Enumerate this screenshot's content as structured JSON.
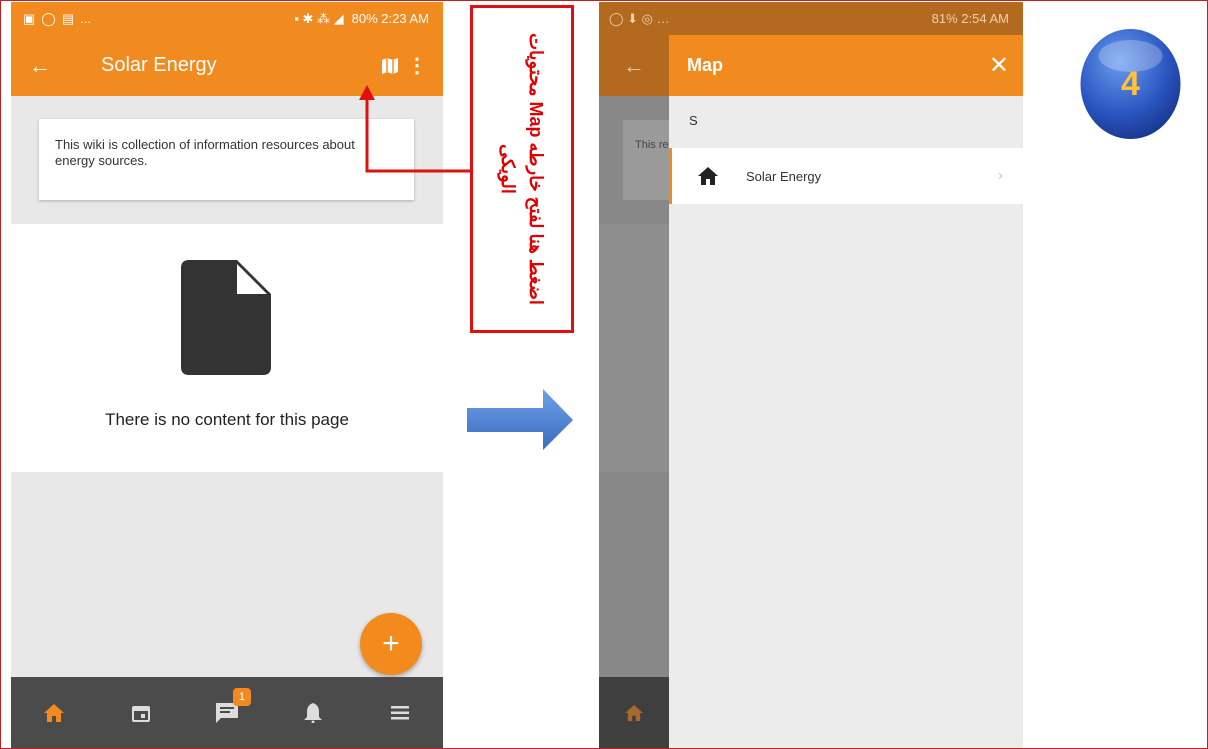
{
  "phone1": {
    "status_left_icons": [
      "image-icon",
      "whatsapp-icon",
      "gallery-icon",
      "..."
    ],
    "status_right": "80% 2:23 AM",
    "title": "Solar Energy",
    "wiki_description": "This wiki is collection of information resources about energy sources.",
    "empty_message": "There is no content for this page",
    "fab_label": "+",
    "nav": [
      {
        "name": "home-icon"
      },
      {
        "name": "calendar-icon"
      },
      {
        "name": "chat-icon",
        "badge": "1"
      },
      {
        "name": "bell-icon"
      },
      {
        "name": "menu-icon"
      }
    ]
  },
  "annotation": {
    "text": "اضغط هنا لفتح خارطه Map محتويات الويكى"
  },
  "phone2": {
    "status_right": "81% 2:54 AM",
    "background_card_text": "This reso",
    "drawer": {
      "title": "Map",
      "close": "✕",
      "section_letter": "S",
      "items": [
        {
          "label": "Solar Energy",
          "icon": "home-icon"
        }
      ]
    }
  },
  "step": {
    "number": "4"
  },
  "colors": {
    "accent": "#f18a1f",
    "annotation_red": "#e01010",
    "arrow_blue": "#4a7fd0"
  }
}
